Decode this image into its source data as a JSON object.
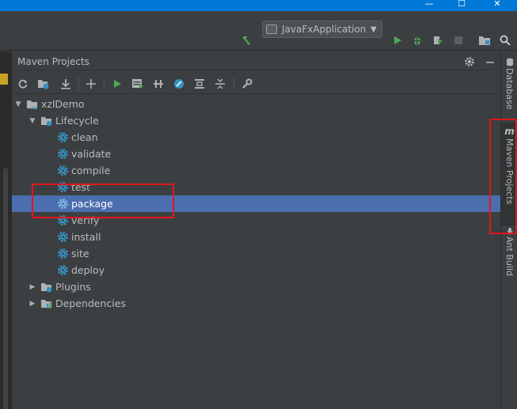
{
  "window": {
    "minimize": "—",
    "maximize": "☐",
    "close": "✕"
  },
  "toolbar": {
    "run_config": "JavaFxApplication"
  },
  "maven_panel": {
    "title": "Maven Projects"
  },
  "tree": {
    "root": "xzlDemo",
    "lifecycle": "Lifecycle",
    "goals": [
      "clean",
      "validate",
      "compile",
      "test",
      "package",
      "verify",
      "install",
      "site",
      "deploy"
    ],
    "selected_goal": "package",
    "plugins": "Plugins",
    "dependencies": "Dependencies"
  },
  "side_tabs": {
    "database": "Database",
    "maven": "Maven Projects",
    "maven_icon": "m",
    "ant": "Ant Build"
  },
  "colors": {
    "panel_bg": "#3c3f41",
    "selection": "#4b6eaf",
    "annotation": "#e0161b",
    "run_green": "#4fa853",
    "gear_blue": "#3592c4"
  }
}
